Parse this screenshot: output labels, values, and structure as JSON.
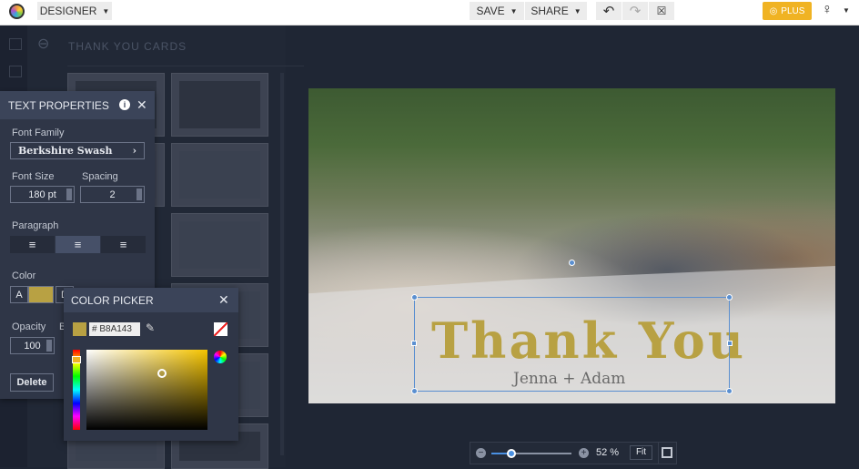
{
  "topbar": {
    "mode": "DESIGNER",
    "save": "SAVE",
    "share": "SHARE",
    "plus": "PLUS"
  },
  "templates": {
    "title": "THANK YOU CARDS"
  },
  "text_properties": {
    "title": "TEXT PROPERTIES",
    "font_family_label": "Font Family",
    "font_family": "Berkshire Swash",
    "font_size_label": "Font Size",
    "font_size": "180 pt",
    "spacing_label": "Spacing",
    "spacing": "2",
    "paragraph_label": "Paragraph",
    "color_label": "Color",
    "color_a": "A",
    "color_d": "D",
    "opacity_label": "Opacity",
    "opacity": "100",
    "b_label": "B",
    "delete": "Delete"
  },
  "color_picker": {
    "title": "COLOR PICKER",
    "hex": "# B8A143",
    "color": "#b8a143"
  },
  "canvas": {
    "title": "Thank You",
    "names": "Jenna + Adam"
  },
  "zoom": {
    "value": "52 %",
    "fit": "Fit",
    "level": 0.25
  }
}
